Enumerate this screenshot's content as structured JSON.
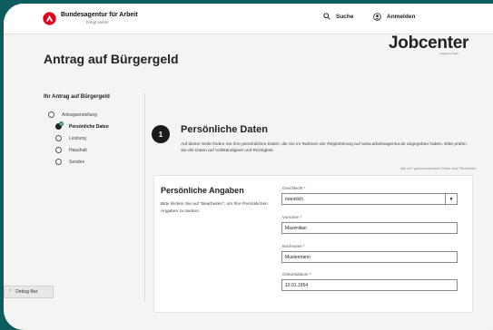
{
  "header": {
    "brand_name": "Bundesagentur für Arbeit",
    "brand_slogan": "bringt weiter.",
    "search_label": "Suche",
    "login_label": "Anmelden"
  },
  "jobcenter": {
    "logo_text": "Jobcenter",
    "sub_text": "Augsburg Stadt"
  },
  "page": {
    "title": "Antrag auf Bürgergeld"
  },
  "sidebar": {
    "title": "Ihr Antrag auf Bürgergeld",
    "steps": [
      {
        "label": "Antragserstellung",
        "state": "done"
      },
      {
        "label": "Persönliche Daten",
        "state": "active"
      },
      {
        "label": "Leistung",
        "state": "open"
      },
      {
        "label": "Haushalt",
        "state": "open"
      },
      {
        "label": "Senden",
        "state": "open"
      }
    ]
  },
  "section": {
    "number": "1",
    "title": "Persönliche Daten",
    "description": "Auf dieser Seite finden Sie ihre persönlichen Daten, die Sie im Rahmen der Registrierung auf www.arbeitsagentur.de angegeben haben. Bitte prüfen Sie die Daten auf Vollständigkeit und Richtigkeit.",
    "required_note": "Alle mit * gekennzeichneten Felder sind Pflichtfelder"
  },
  "card": {
    "title": "Persönliche Angaben",
    "description": "Bitte klicken Sie auf \"Bearbeiten\", um Ihre Persönlichen Angaben zu ändern.",
    "fields": {
      "gender_label": "Geschlecht *",
      "gender_value": "männlich",
      "firstname_label": "Vorname *",
      "firstname_value": "Maximilian",
      "lastname_label": "Nachname *",
      "lastname_value": "Mustermann",
      "birthdate_label": "Geburtsdatum *",
      "birthdate_value": "10.01.1954"
    }
  },
  "debug": {
    "label": "Debug-Bar"
  },
  "colors": {
    "frame": "#0d5c5e",
    "ba_red": "#e3001b",
    "check_green": "#1c8c3c"
  }
}
